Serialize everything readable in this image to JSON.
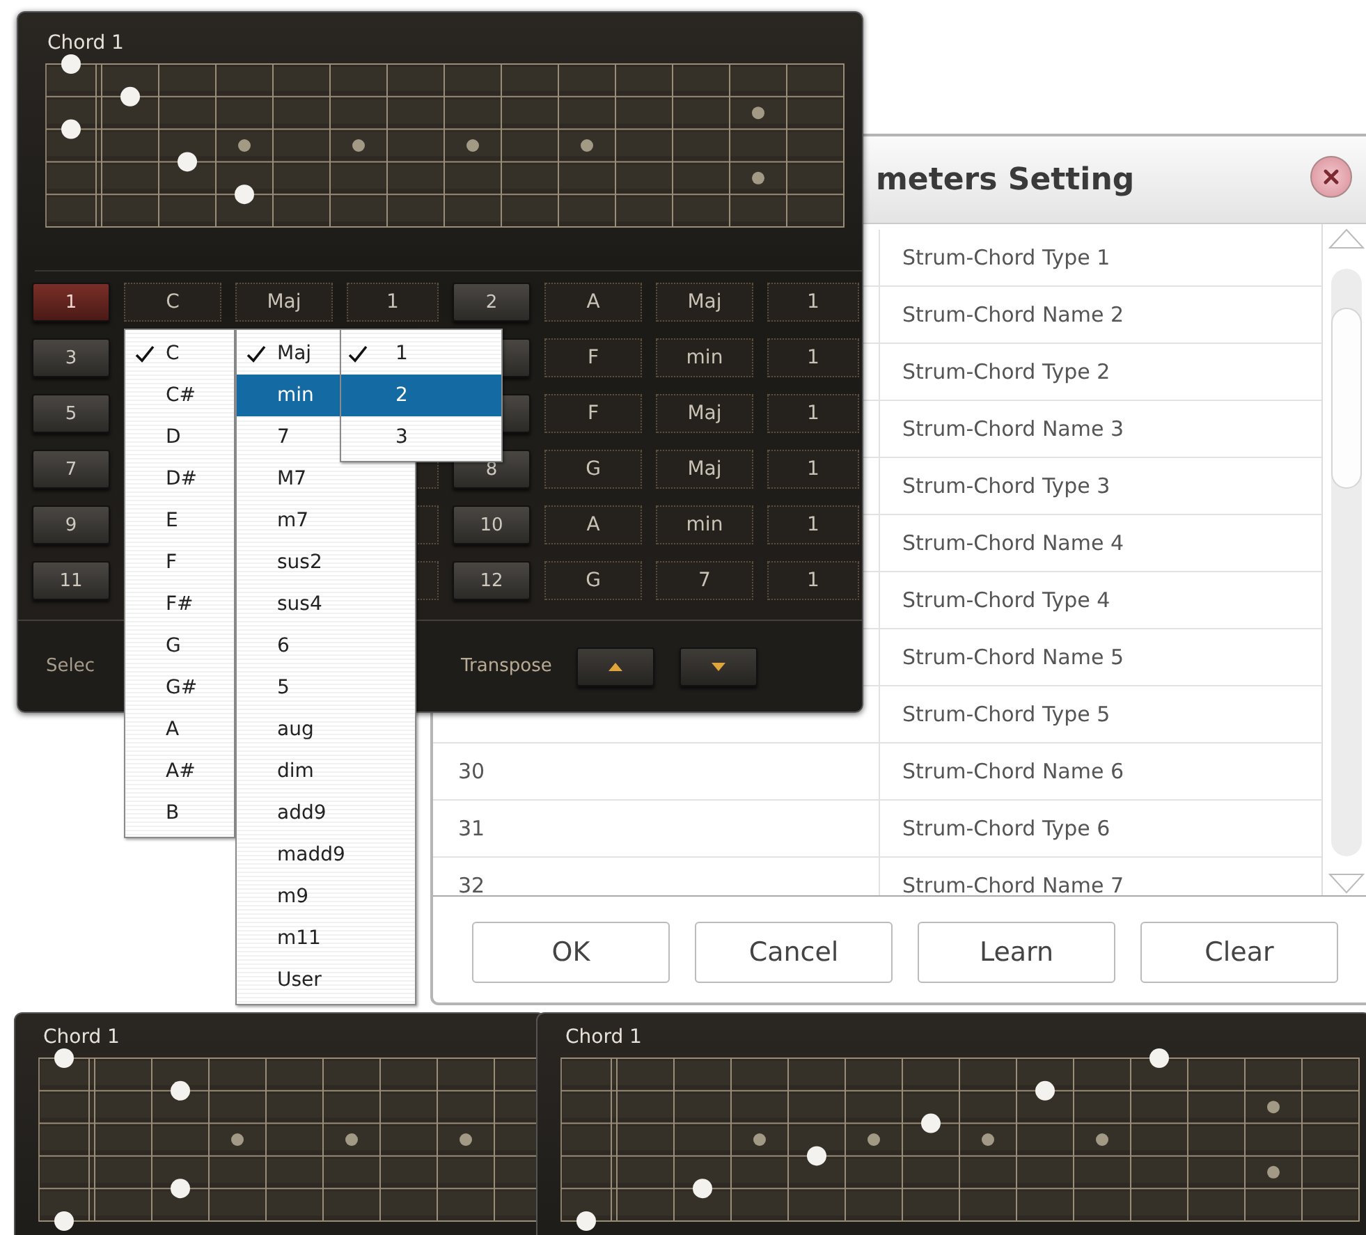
{
  "editor": {
    "title": "Chord 1",
    "slots": [
      {
        "pad": "1",
        "selected": true,
        "note": "C",
        "type": "Maj",
        "voicing": "1"
      },
      {
        "pad": "2",
        "selected": false,
        "note": "A",
        "type": "Maj",
        "voicing": "1"
      },
      {
        "pad": "3",
        "selected": false
      },
      {
        "note": "F",
        "type": "min",
        "voicing": "1"
      },
      {
        "pad": "5",
        "selected": false
      },
      {
        "note": "F",
        "type": "Maj",
        "voicing": "1"
      },
      {
        "pad": "7",
        "selected": false
      },
      {
        "pad": "8",
        "selected": false,
        "note": "G",
        "type": "Maj",
        "voicing": "1"
      },
      {
        "pad": "9",
        "selected": false
      },
      {
        "pad": "10",
        "selected": false,
        "note": "A",
        "type": "min",
        "voicing": "1"
      },
      {
        "pad": "11",
        "selected": false
      },
      {
        "pad": "12",
        "selected": false,
        "note": "G",
        "type": "7",
        "voicing": "1"
      }
    ],
    "select_label": "Selec",
    "transpose_label": "Transpose"
  },
  "menus": {
    "note": [
      {
        "label": "C",
        "checked": true,
        "selected": false
      },
      {
        "label": "C#",
        "checked": false,
        "selected": false
      },
      {
        "label": "D",
        "checked": false,
        "selected": false
      },
      {
        "label": "D#",
        "checked": false,
        "selected": false
      },
      {
        "label": "E",
        "checked": false,
        "selected": false
      },
      {
        "label": "F",
        "checked": false,
        "selected": false
      },
      {
        "label": "F#",
        "checked": false,
        "selected": false
      },
      {
        "label": "G",
        "checked": false,
        "selected": false
      },
      {
        "label": "G#",
        "checked": false,
        "selected": false
      },
      {
        "label": "A",
        "checked": false,
        "selected": false
      },
      {
        "label": "A#",
        "checked": false,
        "selected": false
      },
      {
        "label": "B",
        "checked": false,
        "selected": false
      }
    ],
    "type": [
      {
        "label": "Maj",
        "checked": true,
        "selected": false
      },
      {
        "label": "min",
        "checked": false,
        "selected": true
      },
      {
        "label": "7",
        "checked": false,
        "selected": false
      },
      {
        "label": "M7",
        "checked": false,
        "selected": false
      },
      {
        "label": "m7",
        "checked": false,
        "selected": false
      },
      {
        "label": "sus2",
        "checked": false,
        "selected": false
      },
      {
        "label": "sus4",
        "checked": false,
        "selected": false
      },
      {
        "label": "6",
        "checked": false,
        "selected": false
      },
      {
        "label": "5",
        "checked": false,
        "selected": false
      },
      {
        "label": "aug",
        "checked": false,
        "selected": false
      },
      {
        "label": "dim",
        "checked": false,
        "selected": false
      },
      {
        "label": "add9",
        "checked": false,
        "selected": false
      },
      {
        "label": "madd9",
        "checked": false,
        "selected": false
      },
      {
        "label": "m9",
        "checked": false,
        "selected": false
      },
      {
        "label": "m11",
        "checked": false,
        "selected": false
      },
      {
        "label": "User",
        "checked": false,
        "selected": false
      }
    ],
    "voicing": [
      {
        "label": "1",
        "checked": true,
        "selected": false
      },
      {
        "label": "2",
        "checked": false,
        "selected": true
      },
      {
        "label": "3",
        "checked": false,
        "selected": false
      }
    ]
  },
  "dialog": {
    "title": "meters Setting",
    "rows": [
      {
        "name": "Strum-Chord Type 1"
      },
      {
        "name": "Strum-Chord Name 2"
      },
      {
        "name": "Strum-Chord Type 2"
      },
      {
        "name": "Strum-Chord Name 3"
      },
      {
        "name": "Strum-Chord Type 3"
      },
      {
        "name": "Strum-Chord Name 4"
      },
      {
        "name": "Strum-Chord Type 4"
      },
      {
        "name": "Strum-Chord Name 5"
      },
      {
        "name": "Strum-Chord Type 5"
      },
      {
        "number": "30",
        "name": "Strum-Chord Name 6"
      },
      {
        "number": "31",
        "name": "Strum-Chord Type 6"
      },
      {
        "number": "32",
        "name": "Strum-Chord Name 7"
      }
    ],
    "buttons": [
      "OK",
      "Cancel",
      "Learn",
      "Clear"
    ]
  },
  "previews": [
    {
      "title": "Chord 1"
    },
    {
      "title": "Chord 1"
    }
  ]
}
